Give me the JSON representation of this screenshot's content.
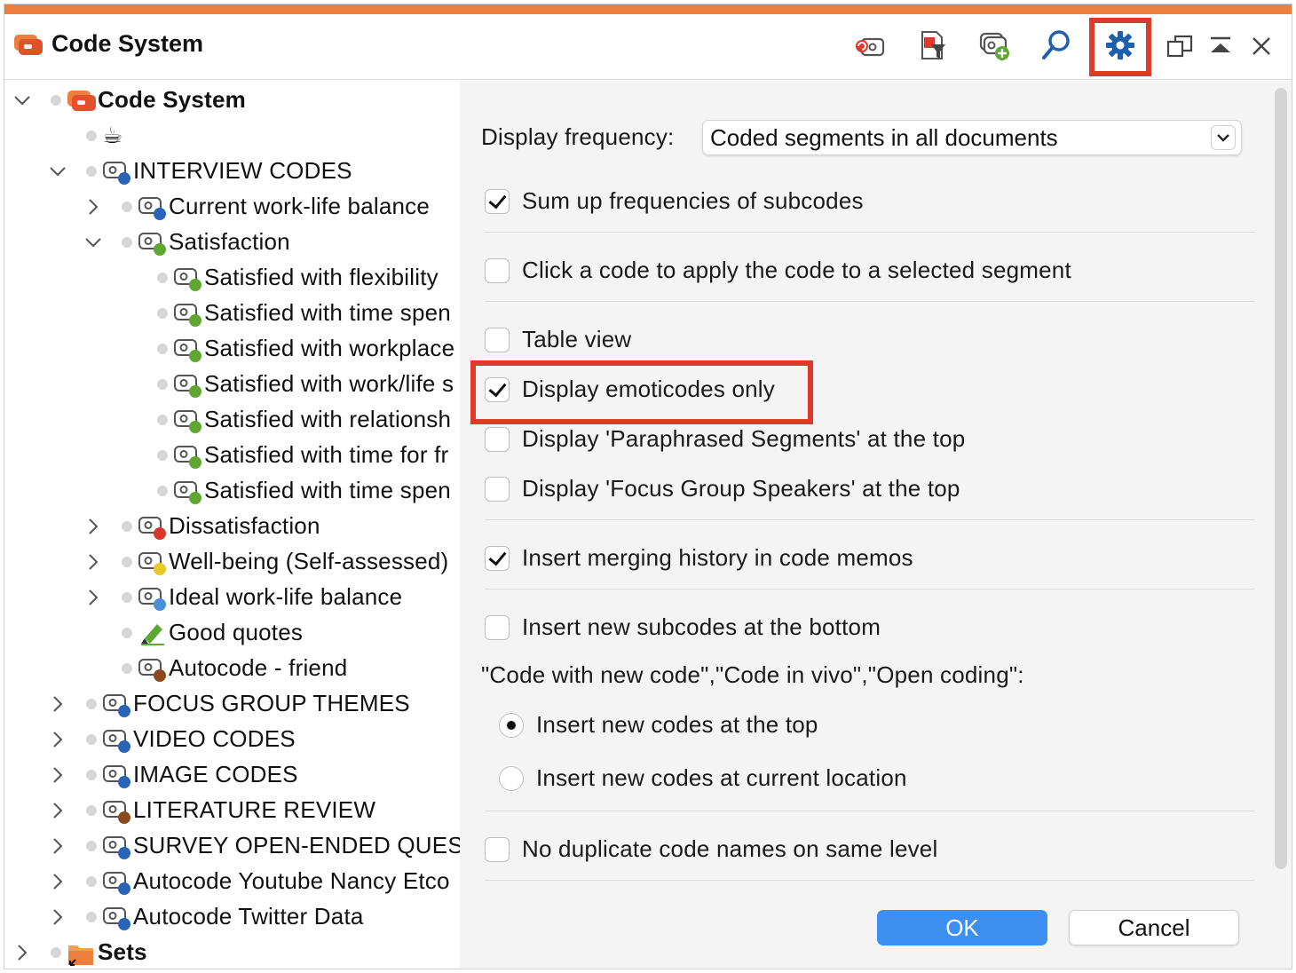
{
  "window": {
    "title": "Code System"
  },
  "toolbar": {
    "icons": [
      "reset-filter-icon",
      "filter-icon",
      "new-code-icon",
      "search-icon",
      "settings-gear-icon"
    ],
    "window_controls": [
      "undock-icon",
      "collapse-icon",
      "close-icon"
    ]
  },
  "tree": {
    "root_label": "Code System",
    "emoji_item": "☕",
    "interview_codes": "INTERVIEW CODES",
    "current_worklife": "Current work-life balance",
    "satisfaction": "Satisfaction",
    "satisfied_items": [
      "Satisfied with flexibility",
      "Satisfied with time spen",
      "Satisfied with workplace",
      "Satisfied with work/life s",
      "Satisfied with relationsh",
      "Satisfied with time for fr",
      "Satisfied with time spen"
    ],
    "dissatisfaction": "Dissatisfaction",
    "wellbeing": "Well-being (Self-assessed)",
    "ideal": "Ideal work-life balance",
    "good_quotes": "Good quotes",
    "autocode_friend": "Autocode - friend",
    "focus_group": "FOCUS GROUP THEMES",
    "video": "VIDEO CODES",
    "image": "IMAGE CODES",
    "literature": "LITERATURE REVIEW",
    "survey": "SURVEY OPEN-ENDED QUEST",
    "autocode_youtube": "Autocode Youtube Nancy Etco",
    "autocode_twitter": "Autocode Twitter Data",
    "sets": "Sets"
  },
  "settings": {
    "display_frequency_label": "Display frequency:",
    "display_frequency_value": "Coded segments in all documents",
    "sum_up": "Sum up frequencies of subcodes",
    "click_apply": "Click a code to apply the code to a selected segment",
    "table_view": "Table view",
    "emoticodes_only": "Display emoticodes only",
    "paraphrased_top": "Display 'Paraphrased Segments' at the top",
    "focus_speakers_top": "Display 'Focus Group Speakers' at the top",
    "merging_history": "Insert merging history in code memos",
    "subcodes_bottom": "Insert new subcodes at the bottom",
    "code_with_new_heading": "\"Code with new code\",\"Code in vivo\",\"Open coding\":",
    "insert_top": "Insert new codes at the top",
    "insert_current": "Insert new codes at current location",
    "no_duplicate": "No duplicate code names on same level",
    "ok": "OK",
    "cancel": "Cancel"
  },
  "colors": {
    "accent_orange": "#ec7f3d",
    "highlight_red": "#e0392b",
    "ok_blue": "#3d8ff0",
    "code_blue": "#2a64b8",
    "code_green": "#5ea832",
    "code_red": "#d9362b",
    "code_yellow": "#e8c928",
    "code_lightblue": "#4a90d9",
    "code_brown": "#8a4a1e"
  }
}
